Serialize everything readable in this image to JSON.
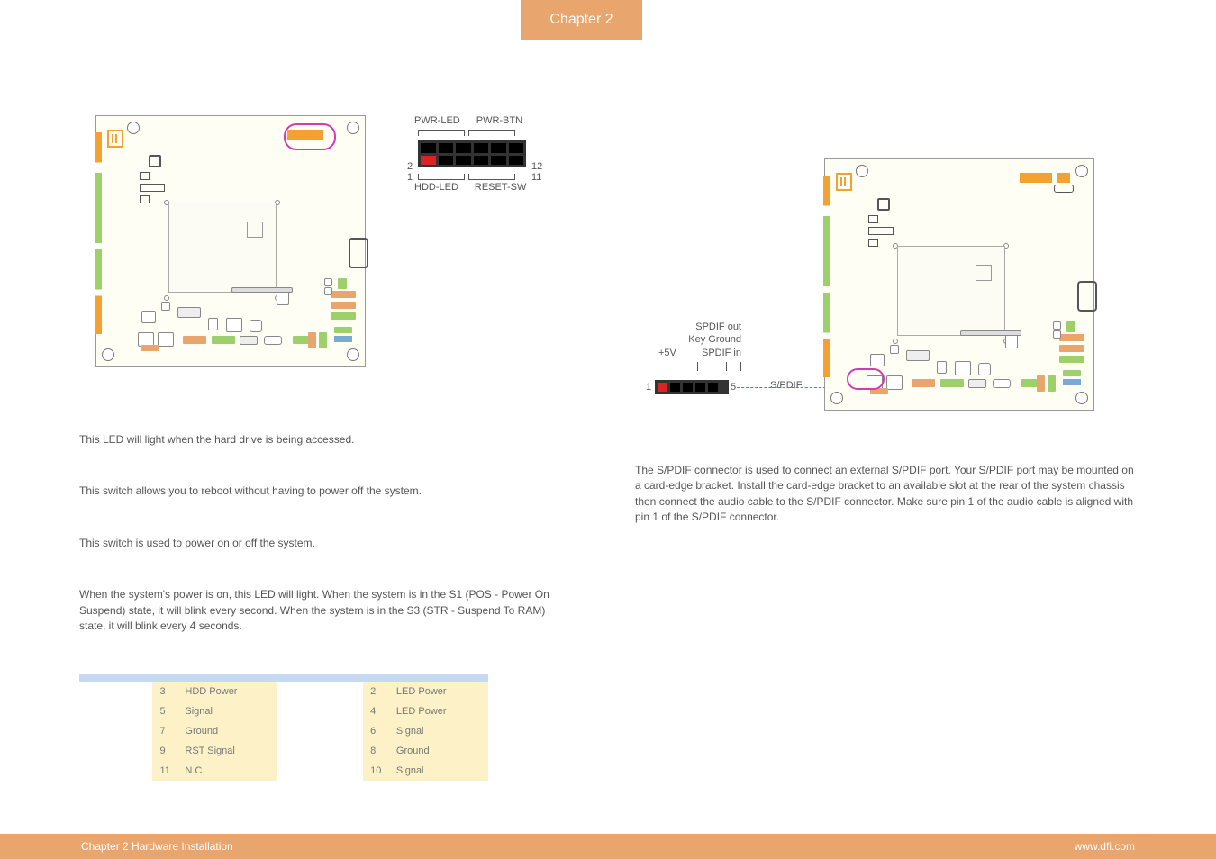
{
  "chapter_tab": "Chapter 2",
  "front_header": {
    "top_left": "PWR-LED",
    "top_right": "PWR-BTN",
    "bot_left": "HDD-LED",
    "bot_right": "RESET-SW",
    "num_tl": "2",
    "num_bl": "1",
    "num_tr": "12",
    "num_br": "11"
  },
  "left_texts": {
    "hdd_led": "This LED will light when the hard drive is being accessed.",
    "reset": "This switch allows you to reboot without having to power off the system.",
    "power": "This switch is used to power on or off the system.",
    "pwr_led": "When the system's power is on, this LED will light. When the system is in the S1 (POS - Power On Suspend) state, it will blink every second. When the system is in the S3 (STR - Suspend To RAM) state, it will blink every 4 seconds."
  },
  "pin_table": {
    "rows": [
      {
        "n1": "3",
        "a1": "HDD Power",
        "n2": "2",
        "a2": "LED Power"
      },
      {
        "n1": "5",
        "a1": "Signal",
        "n2": "4",
        "a2": "LED Power"
      },
      {
        "n1": "7",
        "a1": "Ground",
        "n2": "6",
        "a2": "Signal"
      },
      {
        "n1": "9",
        "a1": "RST Signal",
        "n2": "8",
        "a2": "Ground"
      },
      {
        "n1": "11",
        "a1": "N.C.",
        "n2": "10",
        "a2": "Signal"
      }
    ]
  },
  "spdif": {
    "out": "SPDIF out",
    "key": "Key",
    "ground": "Ground",
    "v5": "+5V",
    "in": "SPDIF in",
    "pin1": "1",
    "pin5": "5",
    "connector_label": "S/PDIF",
    "desc": "The S/PDIF connector is used to connect an external S/PDIF port. Your S/PDIF port may be mounted on a card-edge bracket. Install the card-edge bracket to an available slot at the rear of the system chassis then connect the audio cable to the S/PDIF connector. Make sure pin 1 of the audio cable is aligned with pin 1 of the S/PDIF connector."
  },
  "footer": {
    "left": "Chapter 2 Hardware Installation",
    "right": "www.dfi.com"
  }
}
